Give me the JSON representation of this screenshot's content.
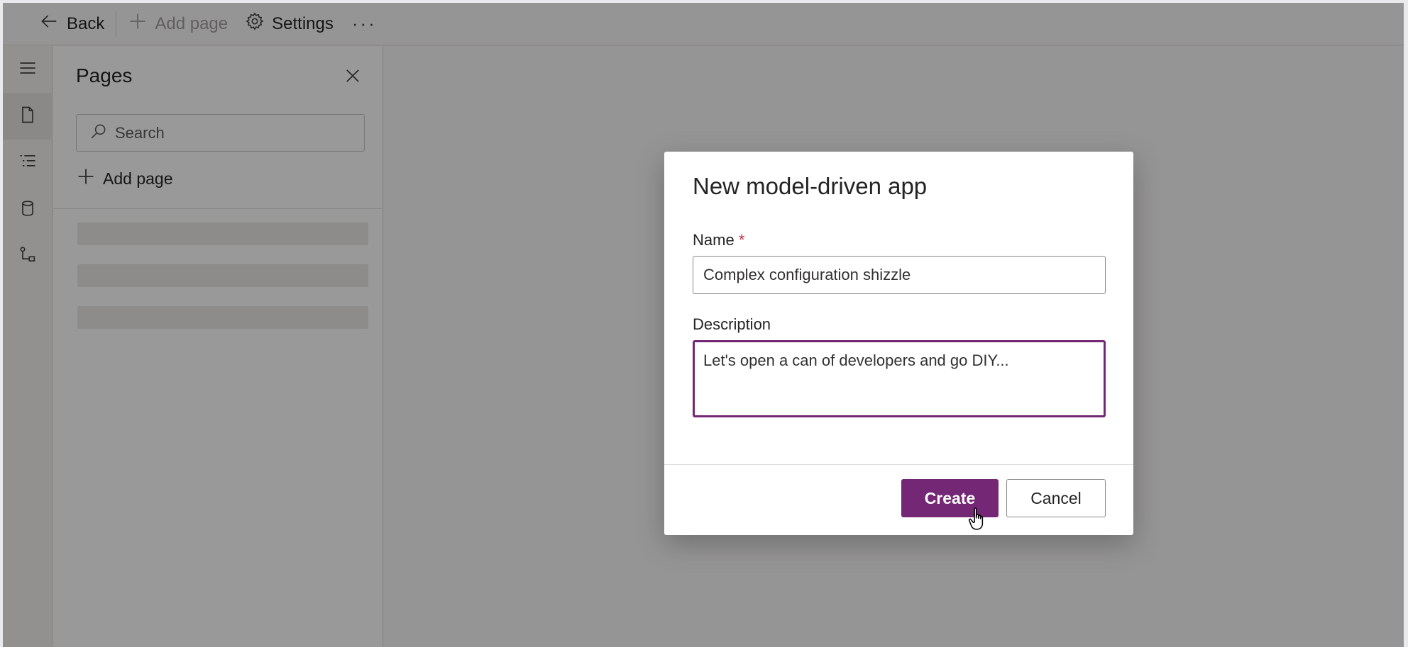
{
  "toolbar": {
    "back_label": "Back",
    "add_page_label": "Add page",
    "settings_label": "Settings",
    "more_label": "···"
  },
  "rail": {
    "items": [
      "menu-icon",
      "pages-icon",
      "navigation-icon",
      "data-icon",
      "automation-icon"
    ]
  },
  "pages_panel": {
    "title": "Pages",
    "search_placeholder": "Search",
    "add_page_label": "Add page"
  },
  "dialog": {
    "title": "New model-driven app",
    "name_label": "Name",
    "required_marker": "*",
    "name_value": "Complex configuration shizzle",
    "description_label": "Description",
    "description_value": "Let's open a can of developers and go DIY...",
    "create_label": "Create",
    "cancel_label": "Cancel"
  },
  "colors": {
    "brand": "#742774",
    "required": "#c4314b"
  }
}
